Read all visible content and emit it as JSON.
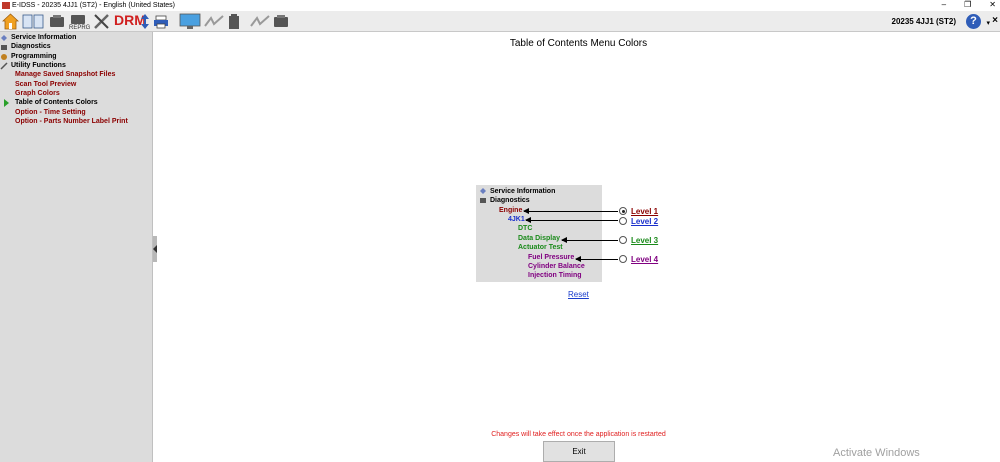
{
  "window": {
    "title": "E-IDSS - 20235 4JJ1 (ST2) - English (United States)",
    "controls": [
      "–",
      "❐",
      "✕"
    ]
  },
  "toolbar": {
    "drm_label": "DRM",
    "vehicle": "20235 4JJ1 (ST2)",
    "help": "?",
    "help_menu": "▾",
    "close": "×"
  },
  "sidebar": {
    "items": [
      {
        "label": "Service Information",
        "icon": "service-info-icon"
      },
      {
        "label": "Diagnostics",
        "icon": "diagnostics-icon"
      },
      {
        "label": "Programming",
        "icon": "programming-icon"
      },
      {
        "label": "Utility Functions",
        "icon": "utility-icon"
      }
    ],
    "sub_items": [
      {
        "label": "Manage Saved Snapshot Files"
      },
      {
        "label": "Scan Tool Preview"
      },
      {
        "label": "Graph Colors"
      },
      {
        "label": "Table of Contents Colors",
        "selected": true
      },
      {
        "label": "Option - Time Setting"
      },
      {
        "label": "Option - Parts Number Label Print"
      }
    ]
  },
  "main": {
    "title": "Table of Contents Menu Colors",
    "preview": {
      "root_items": [
        "Service Information",
        "Diagnostics"
      ],
      "level1": [
        "Engine"
      ],
      "level2": [
        "4JK1"
      ],
      "level3": [
        "DTC",
        "Data Display",
        "Actuator Test"
      ],
      "level4": [
        "Fuel Pressure",
        "Cylinder Balance",
        "Injection Timing"
      ]
    },
    "levels": [
      {
        "label": "Level 1",
        "color": "#8b0000",
        "selected": true
      },
      {
        "label": "Level 2",
        "color": "#1a2fcc",
        "selected": false
      },
      {
        "label": "Level 3",
        "color": "#1a8a1a",
        "selected": false
      },
      {
        "label": "Level 4",
        "color": "#800080",
        "selected": false
      }
    ],
    "reset_label": "Reset",
    "notice": "Changes will take effect once the application is restarted",
    "exit_label": "Exit"
  },
  "watermark": "Activate Windows"
}
